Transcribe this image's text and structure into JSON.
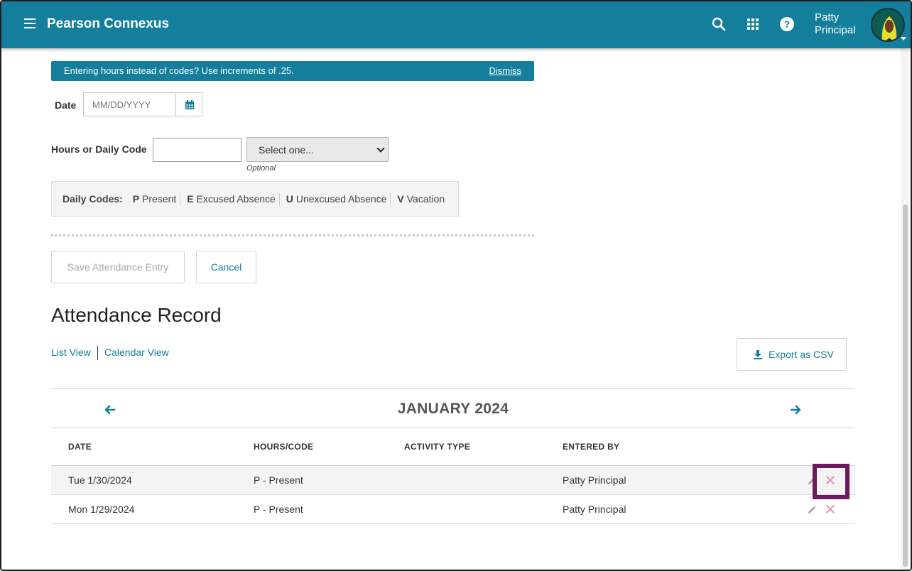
{
  "header": {
    "app_title": "Pearson Connexus",
    "user_first": "Patty",
    "user_last": "Principal",
    "icons": [
      "menu-icon",
      "search-icon",
      "apps-grid-icon",
      "help-icon"
    ],
    "brand_color": "#137f9c"
  },
  "banner": {
    "text": "Entering hours instead of codes? Use increments of .25.",
    "dismiss": "Dismiss"
  },
  "form": {
    "date_label": "Date",
    "date_placeholder": "MM/DD/YYYY",
    "hours_label": "Hours or Daily Code",
    "hours_value": "",
    "select_value": "Select one...",
    "optional_hint": "Optional",
    "codes_title": "Daily Codes:",
    "codes": [
      {
        "key": "P",
        "label": "Present"
      },
      {
        "key": "E",
        "label": "Excused Absence"
      },
      {
        "key": "U",
        "label": "Unexcused Absence"
      },
      {
        "key": "V",
        "label": "Vacation"
      }
    ],
    "save_label": "Save Attendance Entry",
    "cancel_label": "Cancel"
  },
  "record": {
    "title": "Attendance Record",
    "list_view": "List View",
    "calendar_view": "Calendar View",
    "export_label": "Export as CSV",
    "month": "JANUARY 2024",
    "columns": [
      "DATE",
      "HOURS/CODE",
      "ACTIVITY TYPE",
      "ENTERED BY"
    ],
    "rows": [
      {
        "date": "Tue 1/30/2024",
        "code": "P - Present",
        "activity": "",
        "entered_by": "Patty Principal"
      },
      {
        "date": "Mon 1/29/2024",
        "code": "P - Present",
        "activity": "",
        "entered_by": "Patty Principal"
      }
    ]
  }
}
